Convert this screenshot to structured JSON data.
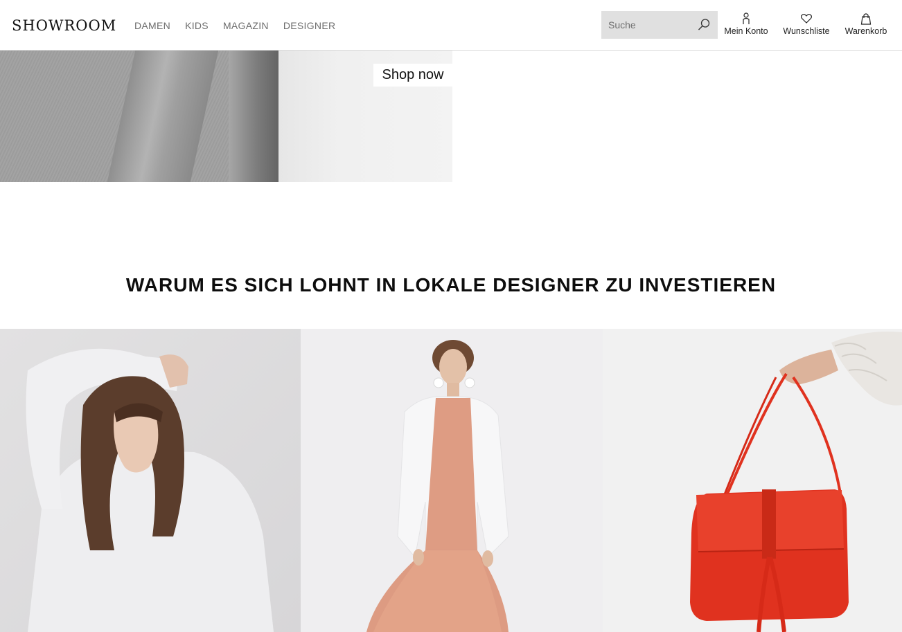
{
  "header": {
    "logo": "SHOWROOM",
    "nav": [
      {
        "label": "DAMEN"
      },
      {
        "label": "KIDS"
      },
      {
        "label": "MAGAZIN"
      },
      {
        "label": "DESIGNER"
      }
    ],
    "search": {
      "placeholder": "Suche",
      "value": "",
      "icon": "search-icon"
    },
    "actions": {
      "account": {
        "label": "Mein Konto",
        "icon": "user-icon"
      },
      "wishlist": {
        "label": "Wunschliste",
        "icon": "heart-icon"
      },
      "cart": {
        "label": "Warenkorb",
        "icon": "shopping-bag-icon"
      }
    }
  },
  "hero": {
    "cta_label": "Shop now"
  },
  "section": {
    "title": "WARUM ES SICH LOHNT IN LOKALE DESIGNER ZU INVESTIEREN"
  },
  "colors": {
    "nav_text": "#6d6d6d",
    "search_bg": "#e0e0e0",
    "bag_red": "#e0321f",
    "dress_peach": "#d98c6e"
  }
}
